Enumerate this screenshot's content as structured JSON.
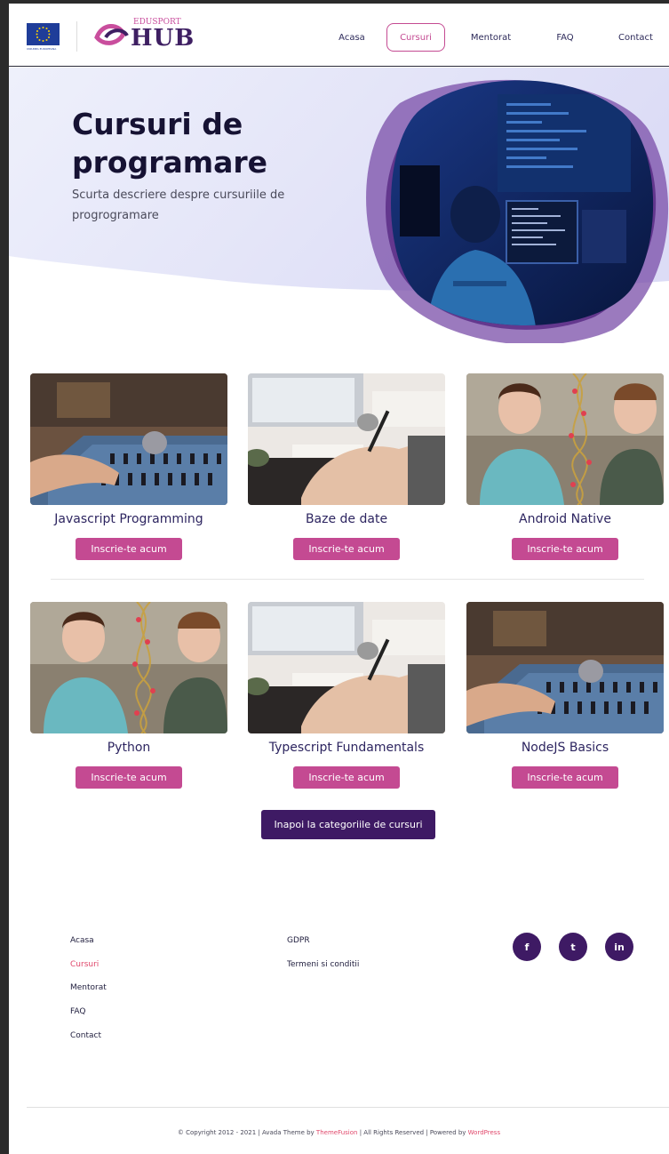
{
  "header": {
    "eu_caption": "UNIUNEA EUROPEANA",
    "logo_sup": "EDUSPORT",
    "logo_main": "HUB",
    "nav": [
      {
        "label": "Acasa",
        "active": false
      },
      {
        "label": "Cursuri",
        "active": true
      },
      {
        "label": "Mentorat",
        "active": false
      },
      {
        "label": "FAQ",
        "active": false
      },
      {
        "label": "Contact",
        "active": false
      }
    ]
  },
  "hero": {
    "title": "Cursuri de programare",
    "description": "Scurta descriere despre cursuriile de progrogramare"
  },
  "courses": [
    {
      "name": "Javascript Programming",
      "button": "Inscrie-te acum",
      "image": "mixer-photo"
    },
    {
      "name": "Baze de date",
      "button": "Inscrie-te acum",
      "image": "writing-desk-photo"
    },
    {
      "name": "Android Native",
      "button": "Inscrie-te acum",
      "image": "dna-students-photo"
    },
    {
      "name": "Python",
      "button": "Inscrie-te acum",
      "image": "dna-students-photo"
    },
    {
      "name": "Typescript Fundamentals",
      "button": "Inscrie-te acum",
      "image": "writing-desk-photo"
    },
    {
      "name": "NodeJS Basics",
      "button": "Inscrie-te acum",
      "image": "mixer-photo"
    }
  ],
  "back_button": "Inapoi la categoriile de cursuri",
  "footer": {
    "col1": [
      "Acasa",
      "Cursuri",
      "Mentorat",
      "FAQ",
      "Contact"
    ],
    "col1_active": "Cursuri",
    "col2": [
      "GDPR",
      "Termeni si conditii"
    ],
    "social": [
      {
        "label": "f",
        "icon": "facebook-icon"
      },
      {
        "label": "t",
        "icon": "twitter-icon"
      },
      {
        "label": "in",
        "icon": "linkedin-icon"
      }
    ],
    "copyright_pre": "© Copyright 2012 - 2021 | Avada Theme by ",
    "copyright_link1": "ThemeFusion",
    "copyright_mid": " | All Rights Reserved | Powered by ",
    "copyright_link2": "WordPress"
  },
  "colors": {
    "accent": "#c44a92",
    "dark_purple": "#3e1a64",
    "footer_link_active": "#e0486b"
  }
}
